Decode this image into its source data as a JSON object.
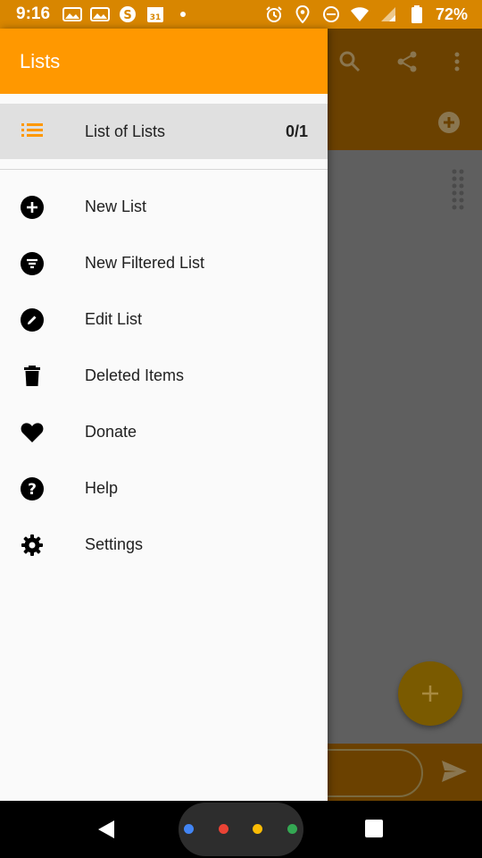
{
  "status_bar": {
    "time": "9:16",
    "battery": "72%",
    "left_icons": [
      "photo-icon",
      "photo-icon",
      "skype-icon",
      "calendar-icon",
      "dot-icon"
    ],
    "right_icons": [
      "alarm-icon",
      "location-icon",
      "dnd-icon",
      "wifi-icon",
      "signal-icon",
      "battery-icon"
    ]
  },
  "drawer": {
    "title": "Lists",
    "selected_list": {
      "label": "List of Lists",
      "count": "0/1",
      "icon": "list-icon"
    },
    "menu": [
      {
        "label": "New List",
        "icon": "add-circle-icon"
      },
      {
        "label": "New Filtered List",
        "icon": "filter-icon"
      },
      {
        "label": "Edit List",
        "icon": "edit-icon"
      },
      {
        "label": "Deleted Items",
        "icon": "trash-icon"
      },
      {
        "label": "Donate",
        "icon": "heart-icon"
      },
      {
        "label": "Help",
        "icon": "help-icon"
      },
      {
        "label": "Settings",
        "icon": "settings-icon"
      }
    ]
  },
  "background_app": {
    "toolbar_icons": [
      "search-icon",
      "share-icon",
      "more-vert-icon"
    ]
  },
  "colors": {
    "accent": "#ff9800",
    "status_bar": "#d88600",
    "drawer_bg": "#fafafa",
    "selected_bg": "#e0e0e0"
  }
}
